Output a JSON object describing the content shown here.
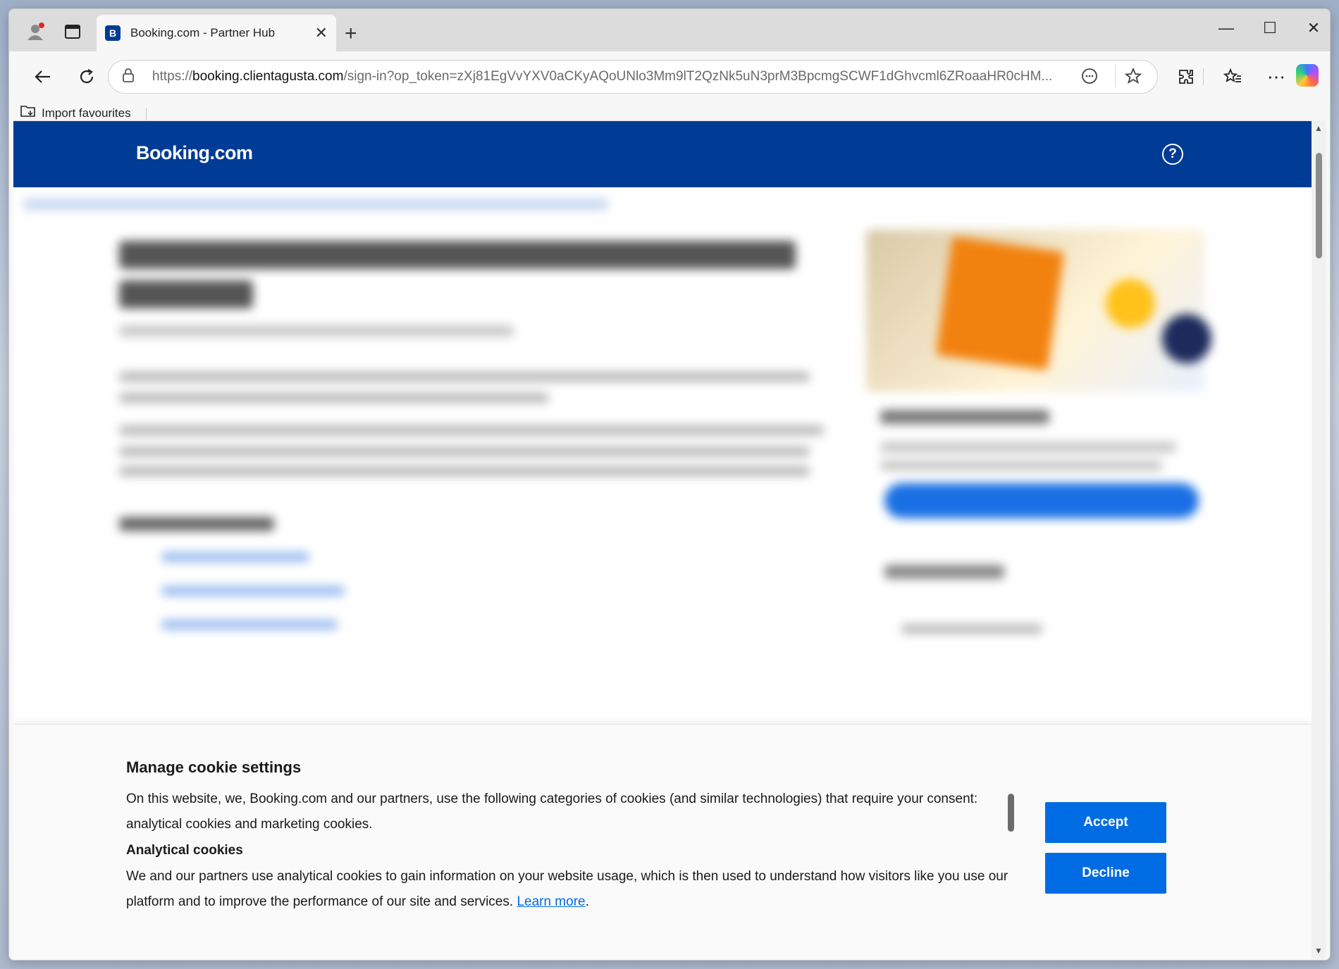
{
  "browser": {
    "tab_title": "Booking.com - Partner Hub",
    "tab_favicon_letter": "B",
    "url_prefix": "https://",
    "url_domain": "booking.clientagusta.com",
    "url_path": "/sign-in?op_token=zXj81EgVvYXV0aCKyAQoUNlo3Mm9lT2QzNk5uN3prM3BpcmgSCWF1dGhvcml6ZRoaaHR0cHM...",
    "favourites": [
      {
        "label": "Import favourites"
      }
    ]
  },
  "site": {
    "logo": "Booking.com",
    "help_icon": "?"
  },
  "cookie_banner": {
    "title": "Manage cookie settings",
    "intro": "On this website, we, Booking.com and our partners, use the following categories of cookies (and similar technologies) that require your consent: analytical cookies and marketing cookies.",
    "section_title": "Analytical cookies",
    "section_text": "We and our partners use analytical cookies to gain information on your website usage, which is then used to understand how visitors like you use our platform and to improve the performance of our site and services.",
    "learn_more": "Learn more",
    "period": ".",
    "accept": "Accept",
    "decline": "Decline"
  },
  "colors": {
    "brand": "#003b95",
    "button": "#006ce4",
    "link": "#006ce4"
  }
}
